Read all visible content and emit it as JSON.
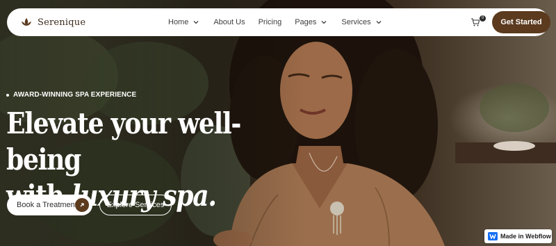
{
  "brand": {
    "name": "Serenique",
    "accent": "#5b3a1e"
  },
  "nav": {
    "items": [
      {
        "label": "Home",
        "has_dropdown": true
      },
      {
        "label": "About Us",
        "has_dropdown": false
      },
      {
        "label": "Pricing",
        "has_dropdown": false
      },
      {
        "label": "Pages",
        "has_dropdown": true
      },
      {
        "label": "Services",
        "has_dropdown": true
      }
    ],
    "cart_icon": "cart-icon",
    "cart_count": "0",
    "cta_label": "Get Started"
  },
  "hero": {
    "eyebrow": "AWARD-WINNING SPA EXPERIENCE",
    "headline_line1": "Elevate your well-being",
    "headline_line2_prefix": "with ",
    "headline_line2_emphasis": "luxury spa.",
    "primary_button": "Book a Treatment",
    "primary_button_icon": "arrow-up-right-icon",
    "secondary_button": "Explore Services"
  },
  "badge": {
    "label": "Made in Webflow",
    "icon": "webflow-icon"
  }
}
